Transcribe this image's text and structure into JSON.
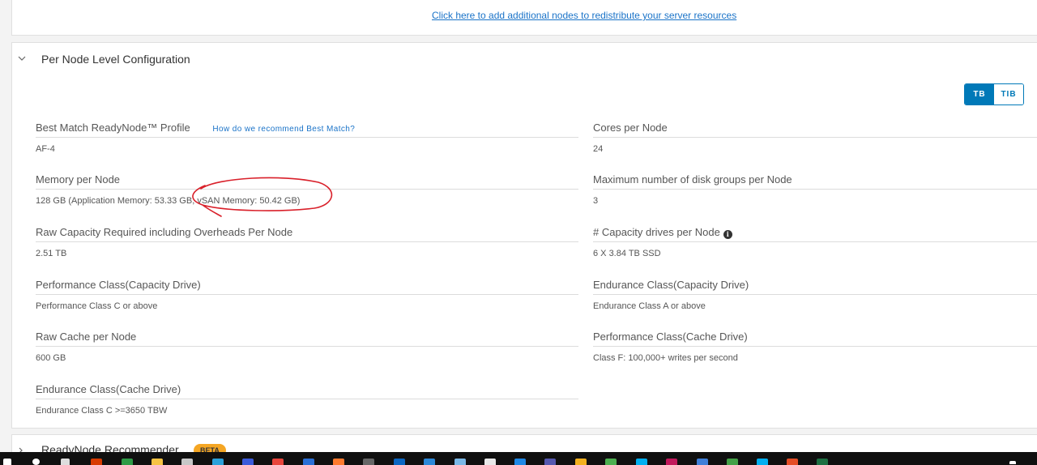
{
  "top": {
    "link_text": "Click here to add additional nodes to redistribute your server resources"
  },
  "section": {
    "title": "Per Node Level Configuration"
  },
  "units": {
    "tb": "TB",
    "tib": "TIB",
    "selected": "TB"
  },
  "left_fields": [
    {
      "label": "Best Match ReadyNode™ Profile",
      "value": "AF-4",
      "help": "How do we recommend Best Match?"
    },
    {
      "label": "Memory per Node",
      "value": "128 GB (Application Memory: 53.33 GB, vSAN Memory: 50.42 GB)"
    },
    {
      "label": "Raw Capacity Required including Overheads Per Node",
      "value": "2.51 TB"
    },
    {
      "label": "Performance Class(Capacity Drive)",
      "value": "Performance Class C or above"
    },
    {
      "label": "Raw Cache per Node",
      "value": "600 GB"
    },
    {
      "label": "Endurance Class(Cache Drive)",
      "value": "Endurance Class C >=3650 TBW"
    }
  ],
  "right_fields": [
    {
      "label": "Cores per Node",
      "value": "24"
    },
    {
      "label": "Maximum number of disk groups per Node",
      "value": "3"
    },
    {
      "label": "# Capacity drives per Node",
      "value": "6 X 3.84 TB SSD"
    },
    {
      "label": "Endurance Class(Capacity Drive)",
      "value": "Endurance Class A or above"
    },
    {
      "label": "Performance Class(Cache Drive)",
      "value": "Class F: 100,000+ writes per second"
    }
  ],
  "bottom": {
    "title": "ReadyNode Recommender",
    "badge": "BETA"
  },
  "colors": {
    "accent": "#0079b8",
    "annotation": "#d9202a",
    "beta": "#f5a623"
  },
  "icons": {
    "info": "info-circle-icon",
    "chevron": "chevron-down-icon"
  }
}
